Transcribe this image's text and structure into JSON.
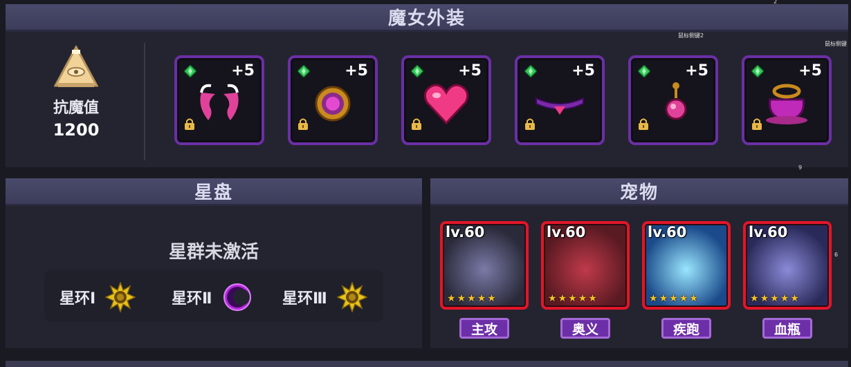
{
  "costume": {
    "title": "魔女外装",
    "resist_label": "抗魔值",
    "resist_value": "1200",
    "slots": [
      {
        "level": "+5",
        "item": "horns"
      },
      {
        "level": "+5",
        "item": "amulet"
      },
      {
        "level": "+5",
        "item": "heart"
      },
      {
        "level": "+5",
        "item": "choker"
      },
      {
        "level": "+5",
        "item": "earring"
      },
      {
        "level": "+5",
        "item": "pot"
      }
    ],
    "debug": [
      "2",
      "鼠标侧键2",
      "鼠标侧键"
    ]
  },
  "starmap": {
    "title": "星盘",
    "status": "星群未激活",
    "rings": [
      {
        "label": "星环Ⅰ",
        "icon": "sun-icon"
      },
      {
        "label": "星环Ⅱ",
        "icon": "moon-icon"
      },
      {
        "label": "星环Ⅲ",
        "icon": "sun-icon"
      }
    ]
  },
  "pets": {
    "title": "宠物",
    "items": [
      {
        "level": "lv.60",
        "stars": 5,
        "tag": "主攻"
      },
      {
        "level": "lv.60",
        "stars": 5,
        "tag": "奥义"
      },
      {
        "level": "lv.60",
        "stars": 5,
        "tag": "疾跑"
      },
      {
        "level": "lv.60",
        "stars": 5,
        "tag": "血瓶"
      }
    ],
    "debug": [
      "9",
      "6"
    ]
  },
  "colors": {
    "accent": "#6b2fa5",
    "pet_frame": "#e2162a",
    "gem": "#35c85a",
    "star": "#f5c12a"
  }
}
